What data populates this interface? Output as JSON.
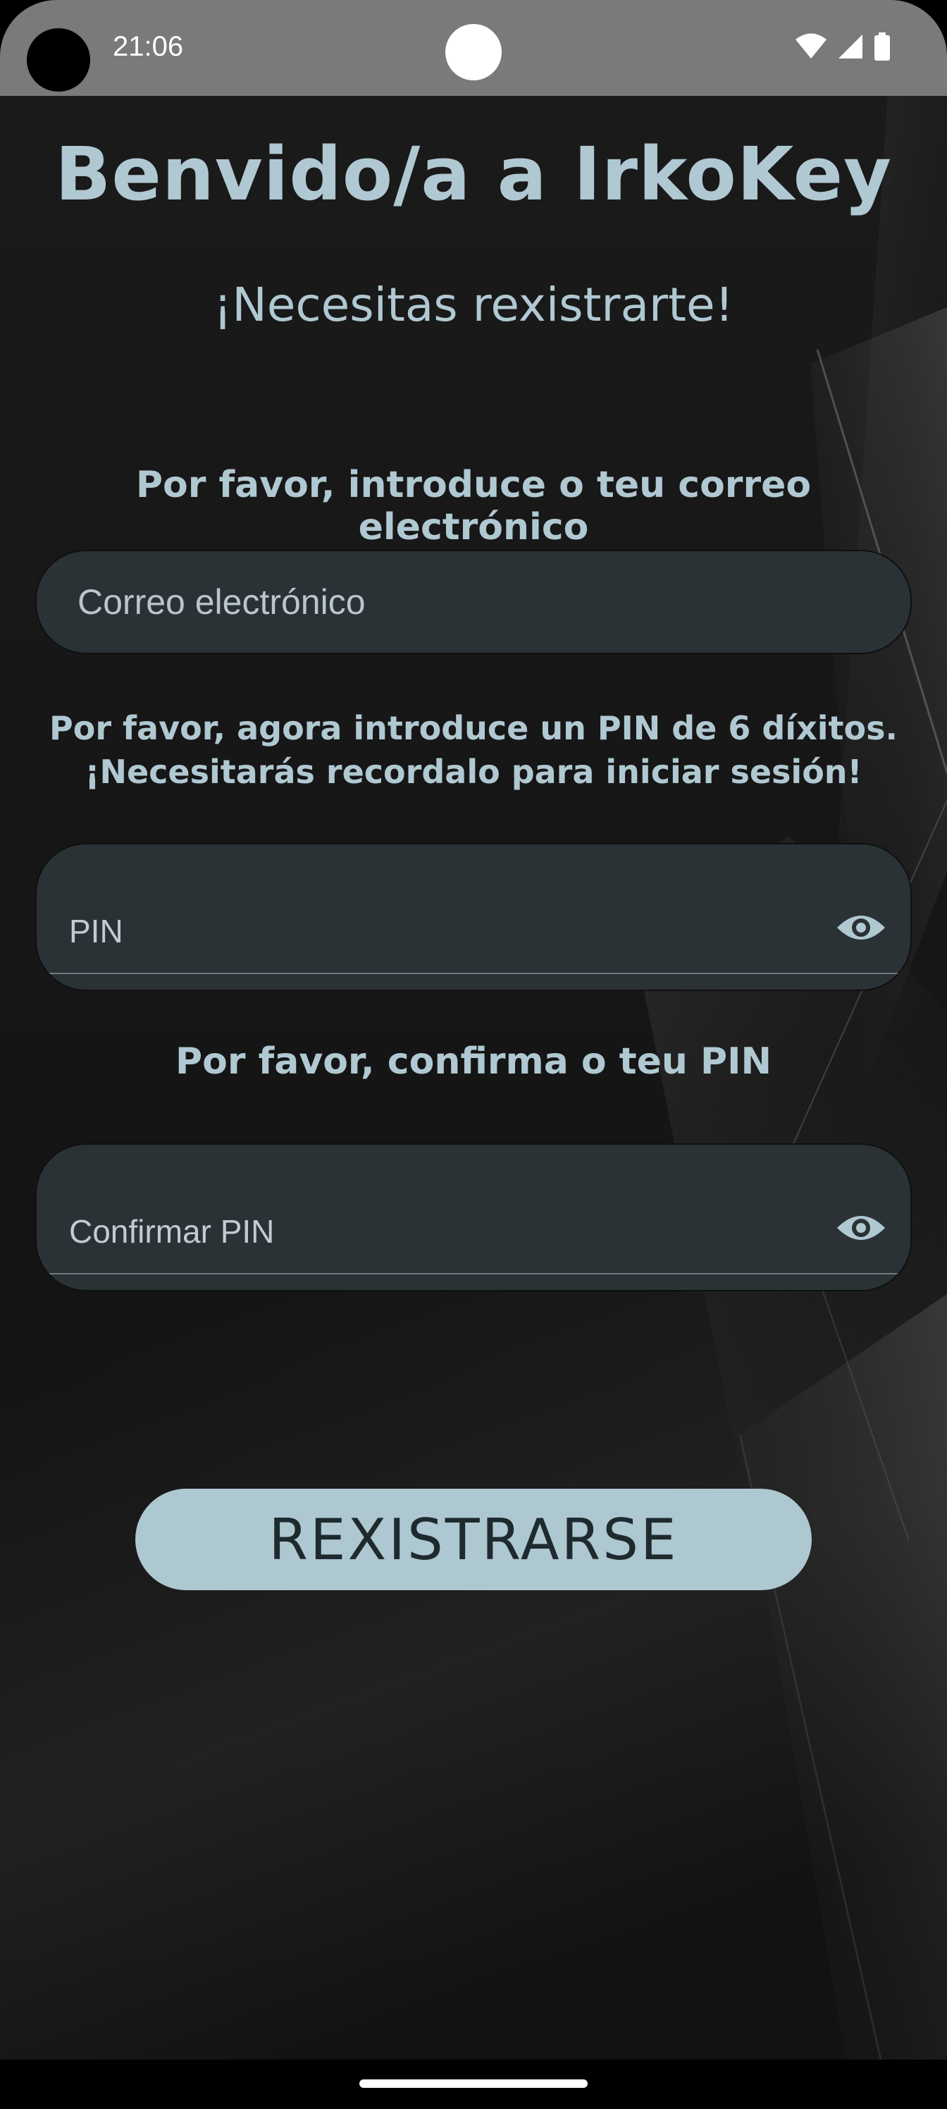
{
  "status_bar": {
    "time": "21:06",
    "icons": [
      "wifi-icon",
      "signal-icon",
      "battery-icon"
    ]
  },
  "screen": {
    "title": "Benvido/a a IrkoKey",
    "subtitle": "¡Necesitas rexistrarte!",
    "email_prompt": "Por favor, introduce o teu correo electrónico",
    "email_placeholder": "Correo electrónico",
    "pin_prompt_line1": "Por favor, agora introduce un PIN de 6 díxitos.",
    "pin_prompt_line2": "¡Necesitarás recordalo para iniciar sesión!",
    "pin_label": "PIN",
    "confirm_prompt": "Por favor, confirma o teu PIN",
    "confirm_label": "Confirmar PIN",
    "register_button": "REXISTRARSE"
  },
  "colors": {
    "accent": "#b0c8d2",
    "field_bg": "#2a3236",
    "button_bg": "#aec8d1",
    "button_text": "#1f2a2f",
    "status_bar_bg": "#7a7a7a"
  }
}
